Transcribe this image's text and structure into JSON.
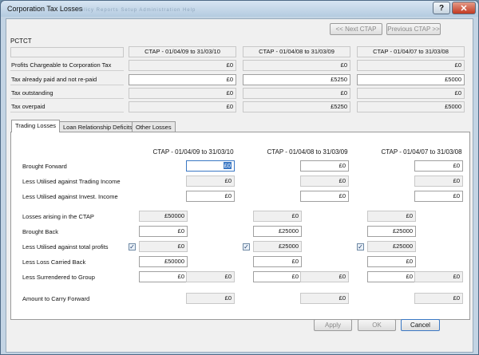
{
  "window": {
    "title": "Corporation Tax Losses",
    "ghost_title": "Policy   Reports   Setup   Administration   Help",
    "help_glyph": "?",
    "close_glyph": "✕"
  },
  "nav": {
    "next_label": "<< Next CTAP",
    "previous_label": "Previous CTAP >>"
  },
  "pctct": {
    "section_label": "PCTCT",
    "periods": [
      "CTAP - 01/04/09 to 31/03/10",
      "CTAP - 01/04/08 to 31/03/09",
      "CTAP - 01/04/07 to 31/03/08"
    ],
    "rows": [
      {
        "label": "Profits Chargeable to Corporation Tax",
        "values": [
          "£0",
          "£0",
          "£0"
        ]
      },
      {
        "label": "Tax already paid and not re-paid",
        "values": [
          "£0",
          "£5250",
          "£5000"
        ]
      },
      {
        "label": "Tax outstanding",
        "values": [
          "£0",
          "£0",
          "£0"
        ]
      },
      {
        "label": "Tax overpaid",
        "values": [
          "£0",
          "£5250",
          "£5000"
        ]
      }
    ]
  },
  "tabs": [
    {
      "label": "Trading Losses",
      "active": true
    },
    {
      "label": "Loan Relationship Deficits",
      "active": false
    },
    {
      "label": "Other Losses",
      "active": false
    }
  ],
  "trading": {
    "periods": [
      "CTAP - 01/04/09 to 31/03/10",
      "CTAP - 01/04/08 to 31/03/09",
      "CTAP - 01/04/07 to 31/03/08"
    ],
    "rows": {
      "brought_forward": {
        "label": "Brought Forward",
        "values": [
          "£0",
          "£0",
          "£0"
        ]
      },
      "utilised_trading": {
        "label": "Less Utilised against Trading Income",
        "values": [
          "£0",
          "£0",
          "£0"
        ]
      },
      "utilised_invest": {
        "label": "Less Utilised against Invest. Income",
        "values": [
          "£0",
          "£0",
          "£0"
        ]
      },
      "arising": {
        "label": "Losses arising in the CTAP",
        "values": [
          "£50000",
          "£0",
          "£0"
        ]
      },
      "brought_back": {
        "label": "Brought Back",
        "values": [
          "£0",
          "£25000",
          "£25000"
        ]
      },
      "utilised_total": {
        "label": "Less Utilised against total profits",
        "values": [
          "£0",
          "£25000",
          "£25000"
        ],
        "checked": [
          true,
          true,
          true
        ]
      },
      "carried_back": {
        "label": "Less Loss Carried Back",
        "values": [
          "£50000",
          "£0",
          "£0"
        ]
      },
      "surrendered": {
        "label": "Less Surrendered to Group",
        "values": [
          "£0",
          "£0",
          "£0"
        ],
        "extra": [
          "£0",
          "£0",
          "£0"
        ]
      },
      "carry_forward": {
        "label": "Amount to Carry Forward",
        "values": [
          "£0",
          "£0",
          "£0"
        ]
      }
    }
  },
  "footer": {
    "apply_label": "Apply",
    "ok_label": "OK",
    "cancel_label": "Cancel"
  }
}
